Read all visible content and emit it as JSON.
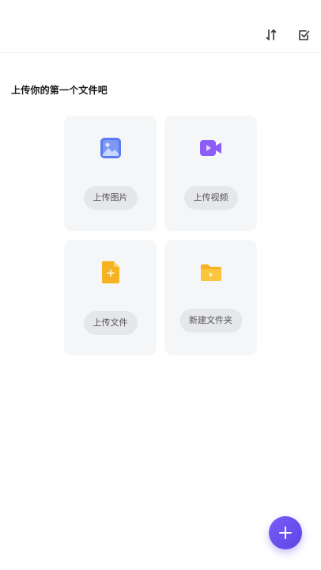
{
  "header": {
    "icons": [
      "sort-icon",
      "multi-select-icon"
    ]
  },
  "main": {
    "heading": "上传你的第一个文件吧",
    "cards": [
      {
        "label": "上传图片",
        "icon": "image-icon",
        "color": "#5b7cf0"
      },
      {
        "label": "上传视频",
        "icon": "video-icon",
        "color": "#8b5cf6"
      },
      {
        "label": "上传文件",
        "icon": "file-icon",
        "color": "#f5b323"
      },
      {
        "label": "新建文件夹",
        "icon": "folder-icon",
        "color": "#f5b323"
      }
    ]
  },
  "fab": {
    "icon": "plus-icon",
    "color": "#6a50ef"
  }
}
